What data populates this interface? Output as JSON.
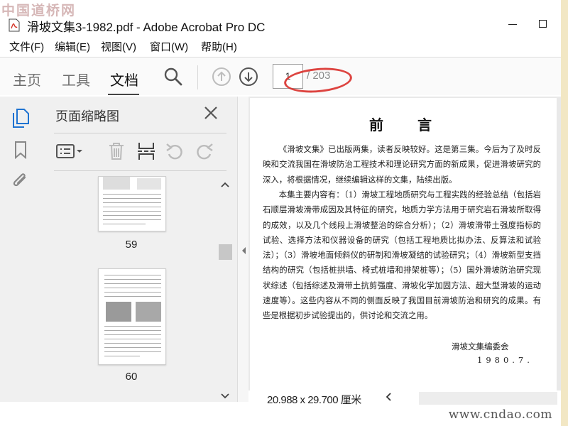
{
  "watermark": {
    "top_left": "中国道桥网",
    "bottom_right": "www.cndao.com"
  },
  "window": {
    "title": "滑坡文集3-1982.pdf - Adobe Acrobat Pro DC"
  },
  "menu": [
    "文件(F)",
    "编辑(E)",
    "视图(V)",
    "窗口(W)",
    "帮助(H)"
  ],
  "toolbar": {
    "tabs": [
      {
        "label": "主页",
        "active": false
      },
      {
        "label": "工具",
        "active": false
      },
      {
        "label": "文档",
        "active": true
      }
    ],
    "current_page": "1",
    "total_pages": "/ 203",
    "highlight_color": "#d9302b"
  },
  "panel": {
    "title": "页面缩略图",
    "thumbnails": [
      {
        "page": "59"
      },
      {
        "page": "60"
      }
    ]
  },
  "document": {
    "title": "前言",
    "paragraphs": [
      "《滑坡文集》已出版两集，读者反映较好。这是第三集。今后为了及时反映和交流我国在滑坡防治工程技术和理论研究方面的新成果，促进滑坡研究的深入，将根据情况，继续编辑这样的文集，陆续出版。",
      "本集主要内容有：（1）滑坡工程地质研究与工程实践的经验总结（包括岩石顺层滑坡滑带成因及其特征的研究，地质力学方法用于研究岩石滑坡所取得的成效，以及几个线段上滑坡整治的综合分析）；（2）滑坡滑带土强度指标的试验、选择方法和仪器设备的研究（包括工程地质比拟办法、反算法和试验法）；（3）滑坡地面倾斜仪的研制和滑坡凝结的试验研究；（4）滑坡新型支挡结构的研究（包括桩拱墙、椅式桩墙和排架桩等）；（5）国外滑坡防治研究现状综述（包括综述及滑带土抗剪强度、滑坡化学加固方法、超大型滑坡的运动速度等）。这些内容从不同的侧面反映了我国目前滑坡防治和研究的成果。有些是根据初步试验提出的，供讨论和交流之用。"
    ],
    "signature": "滑坡文集编委会",
    "date": "1980.7."
  },
  "statusbar": {
    "page_size": "20.988 x 29.700 厘米"
  }
}
